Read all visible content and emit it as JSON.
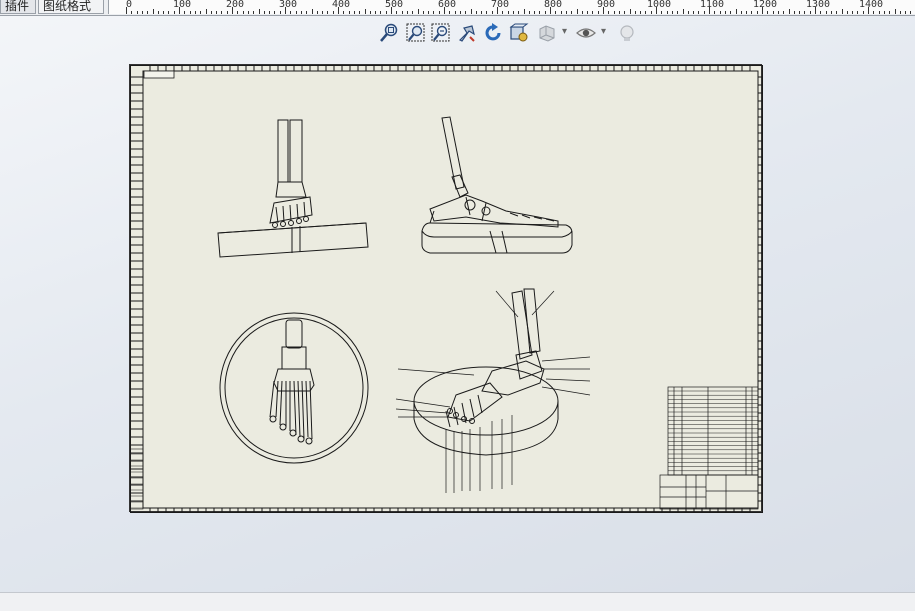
{
  "tabs": [
    {
      "label": "插件"
    },
    {
      "label": "图纸格式"
    }
  ],
  "ruler": {
    "labels": [
      "0",
      "100",
      "200",
      "300",
      "400",
      "500",
      "600",
      "700",
      "800",
      "900",
      "1000",
      "1100",
      "1200",
      "1300",
      "1400"
    ]
  },
  "view_toolbar": {
    "icons": [
      "zoom-to-fit-icon",
      "zoom-to-area-icon",
      "zoom-in-out-icon",
      "pan-icon",
      "rotate-icon",
      "view-orientation-icon",
      "display-style-icon",
      "hide-show-items-icon",
      "apply-scene-icon"
    ],
    "dropdown_glyph": "▾"
  },
  "colors": {
    "sheet_background": "#ebebe0",
    "line": "#1a1a1a",
    "canvas_gradient_start": "#f4f6f9",
    "canvas_gradient_end": "#d8dee7"
  }
}
